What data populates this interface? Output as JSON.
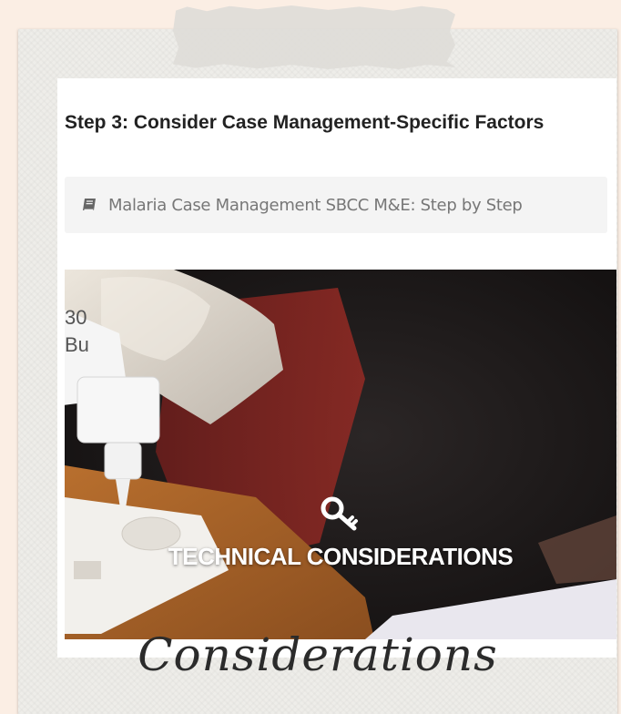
{
  "card": {
    "title": "Step 3: Consider Case Management-Specific Factors",
    "source_label": "Malaria Case Management SBCC M&E: Step by Step"
  },
  "photo": {
    "overlay_label": "TECHNICAL CONSIDERATIONS"
  },
  "caption": "Considerations",
  "icons": {
    "source": "book-icon",
    "overlay": "key-icon"
  },
  "colors": {
    "background": "#fbeee4",
    "polaroid": "#eeede9",
    "title_text": "#222222",
    "source_text": "#777777"
  }
}
